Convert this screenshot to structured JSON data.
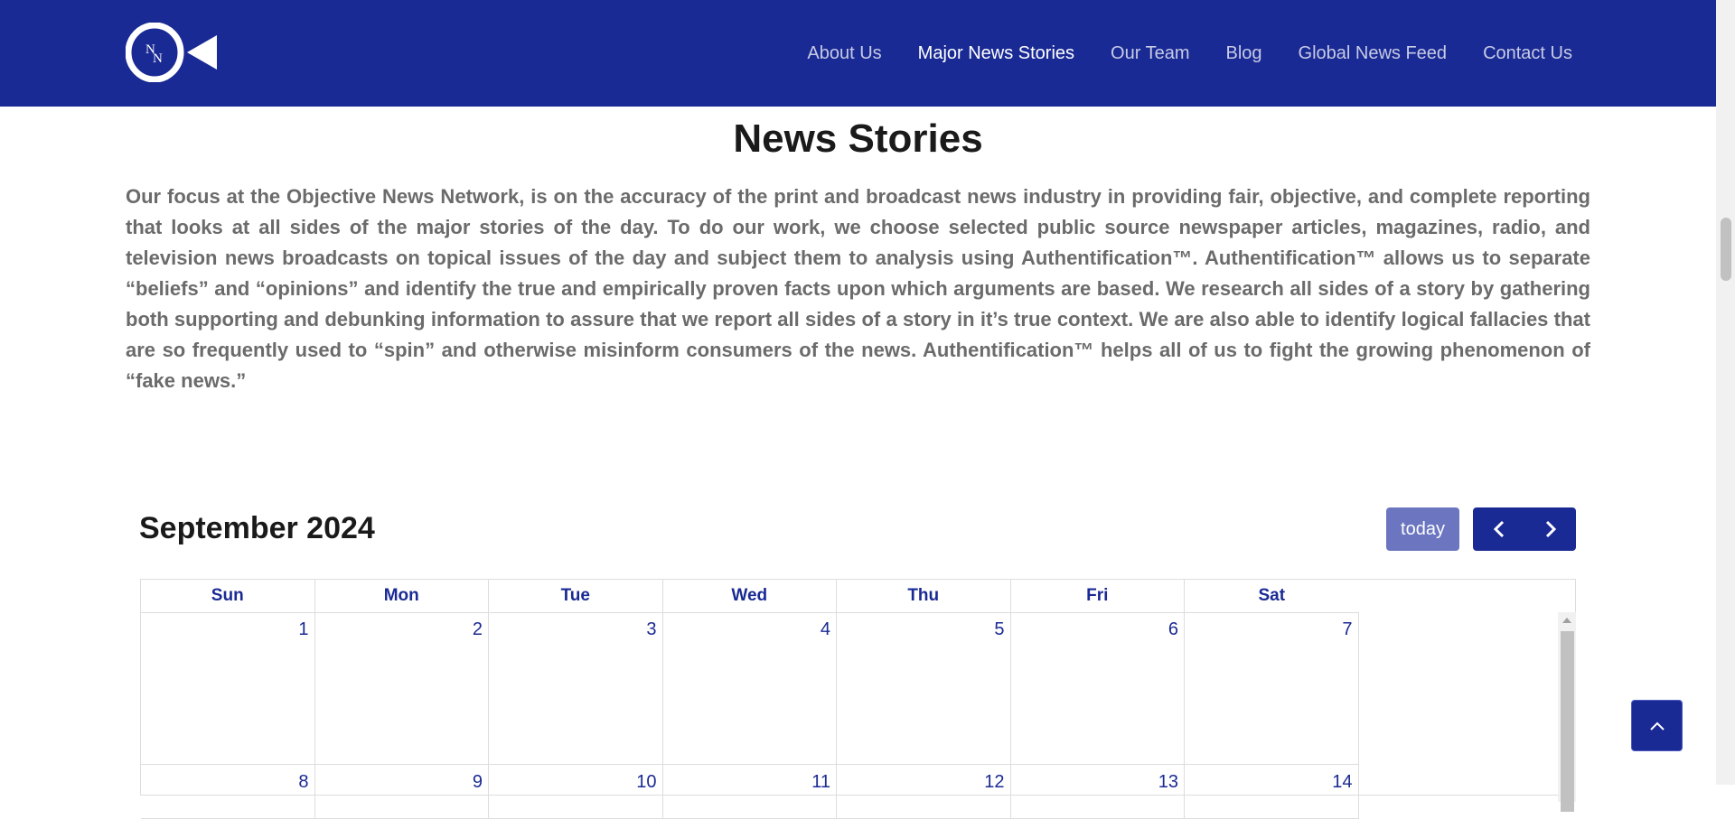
{
  "header": {
    "logo_text": "ON",
    "nav": [
      {
        "label": "About Us"
      },
      {
        "label": "Major News Stories"
      },
      {
        "label": "Our Team"
      },
      {
        "label": "Blog"
      },
      {
        "label": "Global News Feed"
      },
      {
        "label": "Contact Us"
      }
    ],
    "active_nav": "Major News Stories"
  },
  "main": {
    "title": "News Stories",
    "intro": "Our focus at the Objective News Network, is on the accuracy of the print and broadcast news industry in providing fair, objective, and complete reporting that looks at all sides of the major stories of the day. To do our work, we choose selected public source newspaper articles, magazines, radio, and television news broadcasts on topical issues of the day and subject them to analysis using Authentification™. Authentification™ allows us to separate “beliefs” and “opinions” and identify the true and empirically proven facts upon which arguments are based. We research all sides of a story by gathering both supporting and debunking information to assure that we report all sides of a story in it’s true context. We are also able to identify logical fallacies that are so frequently used to “spin” and otherwise misinform consumers of the news. Authentification™ helps all of us to fight the growing phenomenon of “fake news.”"
  },
  "calendar": {
    "title": "September 2024",
    "today_label": "today",
    "days_of_week": [
      "Sun",
      "Mon",
      "Tue",
      "Wed",
      "Thu",
      "Fri",
      "Sat"
    ],
    "weeks": [
      [
        "1",
        "2",
        "3",
        "4",
        "5",
        "6",
        "7"
      ],
      [
        "8",
        "9",
        "10",
        "11",
        "12",
        "13",
        "14"
      ]
    ]
  },
  "colors": {
    "header_bg": "#1a2a94",
    "today_button_bg": "#6b75c0",
    "accent_text": "#1a2a94",
    "intro_text": "#6b6b6b"
  },
  "icons": {
    "prev": "chevron-left-icon",
    "next": "chevron-right-icon",
    "back_to_top": "chevron-up-icon"
  }
}
